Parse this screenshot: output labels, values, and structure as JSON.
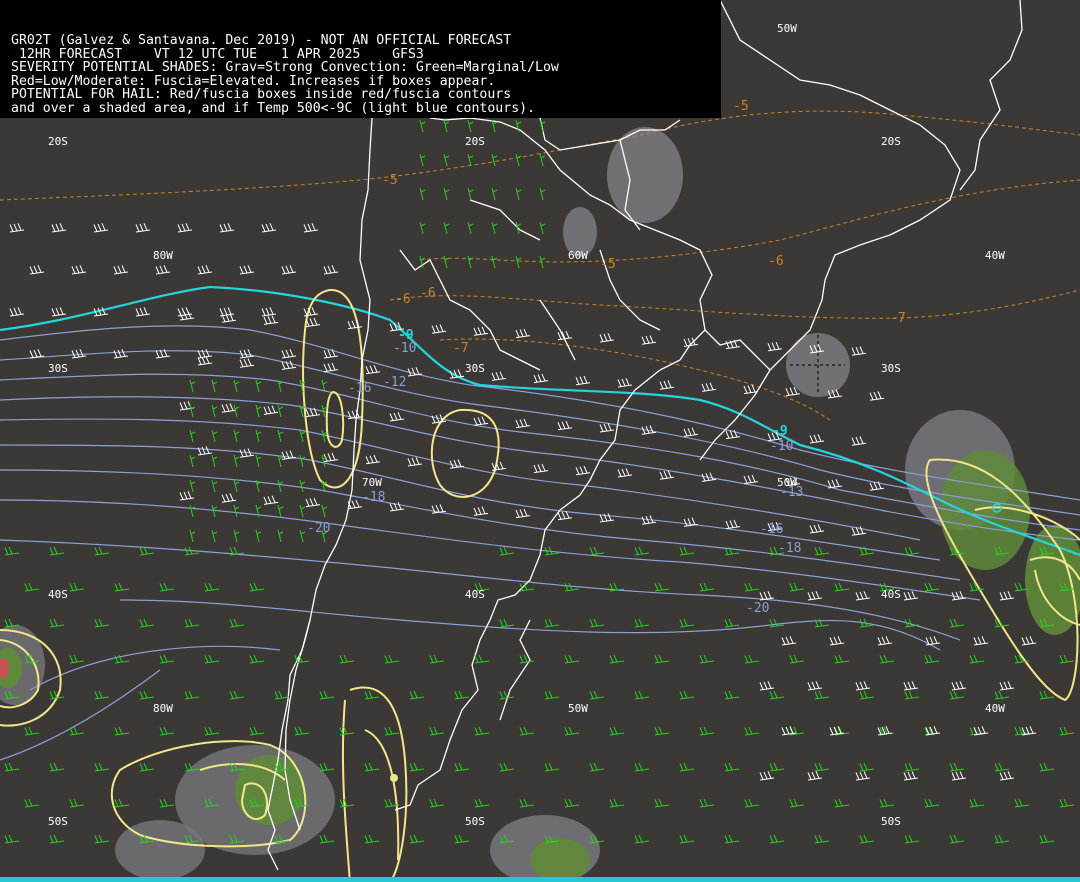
{
  "header": {
    "line1": "GR02T (Galvez & Santavana. Dec 2019) - NOT AN OFFICIAL FORECAST",
    "line2": " 12HR FORECAST    VT 12 UTC TUE   1 APR 2025    GFS3",
    "line3": "SEVERITY POTENTIAL SHADES: Grav=Strong Convection: Green=Marginal/Low",
    "line4": "Red=Low/Moderate: Fuscia=Elevated. Increases if boxes appear.",
    "line5": "POTENTIAL FOR HAIL: Red/fuscia boxes inside red/fuscia contours",
    "line6": "and over a shaded area, and if Temp 500<-9C (light blue contours)."
  },
  "grid_labels": {
    "lon_50w_top": "50W",
    "lat_20s_a": "20S",
    "lat_20s_b": "20S",
    "lat_20s_c": "20S",
    "lon_80w_a": "80W",
    "lon_60w_a": "60W",
    "lon_40w_a": "40W",
    "lat_30s_a": "30S",
    "lat_30s_b": "30S",
    "lat_30s_c": "30S",
    "lon_70w": "70W",
    "lon_50w_mid": "50W",
    "lat_40s_a": "40S",
    "lat_40s_b": "40S",
    "lat_40s_c": "40S",
    "lon_80w_b": "80W",
    "lon_50w_b": "50W",
    "lon_40w_b": "40W",
    "lat_50s_a": "50S",
    "lat_50s_b": "50S",
    "lat_50s_c": "50S"
  },
  "temperature_labels": {
    "t_m5_a": "-5",
    "t_m5_b": "-5",
    "t_m5_c": "-5",
    "t_m6_a": "-6",
    "t_m6_b": "-6",
    "t_m6_c": "-6",
    "t_m7_a": "-7",
    "t_m7_b": "-7",
    "t_m9_a": "-9",
    "t_m9_b": "-9",
    "t_m10_a": "-10",
    "t_m10_b": "-10",
    "t_m12": "-12",
    "t_m13": "-13",
    "t_m16_a": "-16",
    "t_m16_b": "-16",
    "t_m18_a": "-18",
    "t_m18_b": "-18",
    "t_m20_a": "-20",
    "t_m20_b": "-20"
  },
  "colors": {
    "background": "#3b3835",
    "coastline": "#ffffff",
    "cold_contour": "#22d6e0",
    "temp_contour": "#8aa0d8",
    "warm_contour": "#c8842a",
    "severity_contour": "#f2e68a",
    "marginal_shade": "#5f8a3a",
    "strong_shade": "#77777c",
    "wind_barb_green": "#27d11e",
    "wind_barb_white": "#ffffff"
  }
}
